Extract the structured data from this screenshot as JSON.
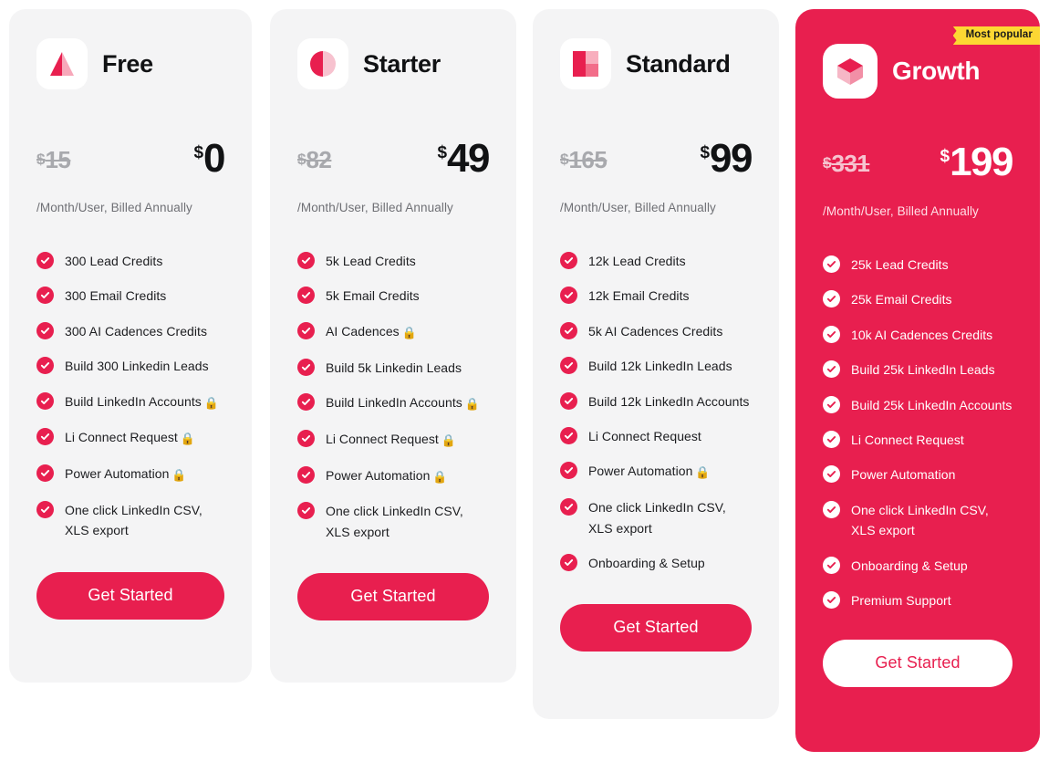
{
  "brand": {
    "accent": "#e81f4f",
    "accent_light": "#f7a8ba",
    "card_bg": "#f4f4f5",
    "ribbon_bg": "#fdd733",
    "lock_glyph": "🔒"
  },
  "badge": {
    "label": "Most popular"
  },
  "plans": [
    {
      "id": "free",
      "name": "Free",
      "icon": "prism-icon",
      "featured": false,
      "currency": "$",
      "price_old": "15",
      "price_new": "0",
      "billing": "/Month/User, Billed Annually",
      "cta": "Get Started",
      "features": [
        {
          "text": "300 Lead Credits",
          "locked": false
        },
        {
          "text": "300 Email Credits",
          "locked": false
        },
        {
          "text": "300 AI Cadences Credits",
          "locked": false
        },
        {
          "text": "Build 300 Linkedin Leads",
          "locked": false
        },
        {
          "text": "Build LinkedIn Accounts",
          "locked": true
        },
        {
          "text": "Li Connect Request",
          "locked": true
        },
        {
          "text": "Power Automation",
          "locked": true
        },
        {
          "text": "One click LinkedIn CSV, XLS export",
          "locked": false
        }
      ]
    },
    {
      "id": "starter",
      "name": "Starter",
      "icon": "half-circle-icon",
      "featured": false,
      "currency": "$",
      "price_old": "82",
      "price_new": "49",
      "billing": "/Month/User, Billed Annually",
      "cta": "Get Started",
      "features": [
        {
          "text": "5k Lead Credits",
          "locked": false
        },
        {
          "text": "5k Email Credits",
          "locked": false
        },
        {
          "text": "AI Cadences",
          "locked": true
        },
        {
          "text": "Build 5k Linkedin Leads",
          "locked": false
        },
        {
          "text": "Build LinkedIn Accounts",
          "locked": true
        },
        {
          "text": "Li Connect Request",
          "locked": true
        },
        {
          "text": "Power Automation",
          "locked": true
        },
        {
          "text": "One click LinkedIn CSV, XLS export",
          "locked": false
        }
      ]
    },
    {
      "id": "standard",
      "name": "Standard",
      "icon": "split-square-icon",
      "featured": false,
      "currency": "$",
      "price_old": "165",
      "price_new": "99",
      "billing": "/Month/User, Billed Annually",
      "cta": "Get Started",
      "features": [
        {
          "text": "12k Lead Credits",
          "locked": false
        },
        {
          "text": "12k Email Credits",
          "locked": false
        },
        {
          "text": "5k AI Cadences Credits",
          "locked": false
        },
        {
          "text": "Build 12k LinkedIn Leads",
          "locked": false
        },
        {
          "text": "Build 12k LinkedIn Accounts",
          "locked": false
        },
        {
          "text": "Li Connect Request",
          "locked": false
        },
        {
          "text": "Power Automation",
          "locked": true
        },
        {
          "text": "One click LinkedIn CSV, XLS export",
          "locked": false
        },
        {
          "text": "Onboarding & Setup",
          "locked": false
        }
      ]
    },
    {
      "id": "growth",
      "name": "Growth",
      "icon": "cube-icon",
      "featured": true,
      "currency": "$",
      "price_old": "331",
      "price_new": "199",
      "billing": "/Month/User, Billed Annually",
      "cta": "Get Started",
      "features": [
        {
          "text": "25k Lead Credits",
          "locked": false
        },
        {
          "text": "25k Email Credits",
          "locked": false
        },
        {
          "text": "10k AI Cadences Credits",
          "locked": false
        },
        {
          "text": "Build 25k LinkedIn Leads",
          "locked": false
        },
        {
          "text": "Build 25k LinkedIn Accounts",
          "locked": false
        },
        {
          "text": "Li Connect Request",
          "locked": false
        },
        {
          "text": "Power Automation",
          "locked": false
        },
        {
          "text": "One click LinkedIn CSV, XLS export",
          "locked": false
        },
        {
          "text": "Onboarding & Setup",
          "locked": false
        },
        {
          "text": "Premium Support",
          "locked": false
        }
      ]
    }
  ]
}
